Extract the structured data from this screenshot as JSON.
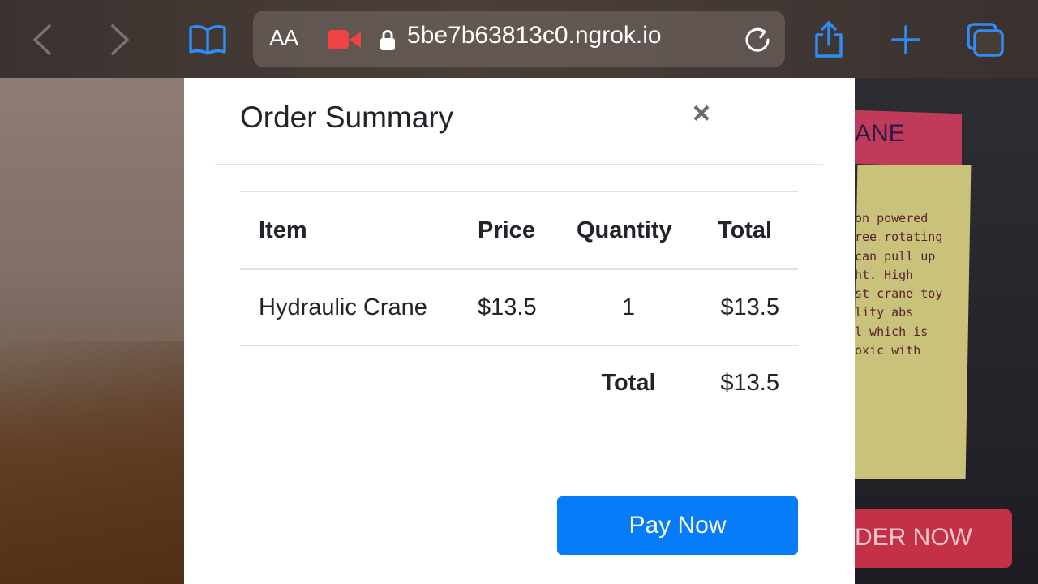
{
  "browser": {
    "text_size_label": "AA",
    "url": "5be7b63813c0.ngrok.io",
    "icons": [
      "chevron-left-icon",
      "chevron-right-icon",
      "bookmarks-icon",
      "text-size-icon",
      "screen-recording-icon",
      "lock-icon",
      "reload-icon",
      "share-icon",
      "plus-icon",
      "tabs-icon"
    ],
    "colors": {
      "accent": "#2f8cf5",
      "recording": "#f04343"
    }
  },
  "background_page": {
    "product_heading_fragment": "ANE",
    "description_fragments": [
      "on powered",
      "ree rotating",
      "can pull up",
      "ht. High",
      "st crane toy",
      "lity abs",
      "l which is",
      "oxic with"
    ],
    "order_button_fragment": "DER NOW"
  },
  "modal": {
    "title": "Order Summary",
    "close_label": "×",
    "table": {
      "headers": {
        "item": "Item",
        "price": "Price",
        "quantity": "Quantity",
        "total": "Total"
      },
      "rows": [
        {
          "item": "Hydraulic Crane",
          "price": "$13.5",
          "quantity": "1",
          "total": "$13.5"
        }
      ],
      "grand_total_label": "Total",
      "grand_total_value": "$13.5"
    },
    "pay_button_label": "Pay Now",
    "colors": {
      "pay_button": "#077cf9",
      "title_text": "#212529"
    }
  }
}
